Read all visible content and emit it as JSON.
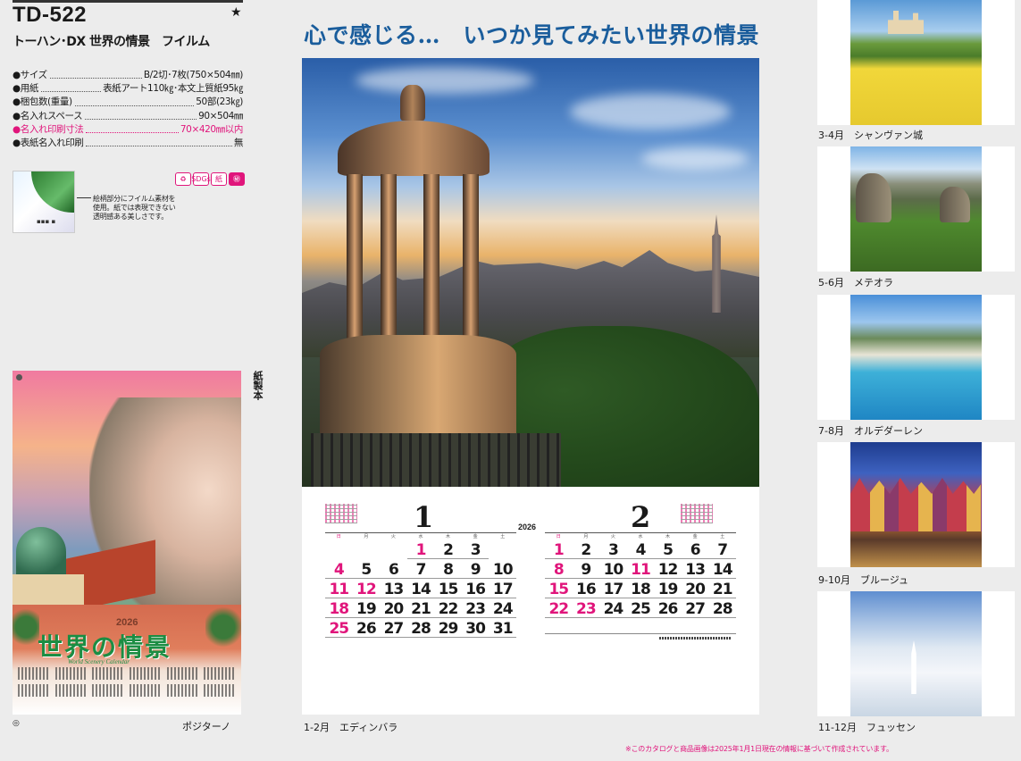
{
  "product": {
    "code": "TD-522",
    "star": "★",
    "name": "トーハン･DX 世界の情景　フイルム"
  },
  "specs": [
    {
      "label": "●サイズ",
      "value": "B/2切･7枚(750×504㎜)",
      "highlight": false
    },
    {
      "label": "●用紙",
      "value": "表紙アート110㎏･本文上質紙95㎏",
      "highlight": false
    },
    {
      "label": "●梱包数(重量)",
      "value": "50部(23㎏)",
      "highlight": false
    },
    {
      "label": "●名入れスペース",
      "value": "90×504㎜",
      "highlight": false
    },
    {
      "label": "●名入れ印刷寸法",
      "value": "70×420㎜以内",
      "highlight": true
    },
    {
      "label": "●表紙名入れ印刷",
      "value": "無",
      "highlight": false
    }
  ],
  "film_note": [
    "絵柄部分にフイルム素材を",
    "使用。紙では表現できない",
    "透明感ある美しさです。"
  ],
  "badges": [
    "♻",
    "SDGs",
    "紙",
    "㊙"
  ],
  "cover": {
    "year": "2026",
    "title": "世界の情景",
    "subtitle": "World Scenery Calendar",
    "side_label": "紙製本",
    "caption": "ポジターノ",
    "mark": "◎"
  },
  "headline": "心で感じる…　いつか見てみたい世界の情景",
  "calendar": {
    "year": "2026",
    "weekday_headers": [
      "日",
      "月",
      "火",
      "水",
      "木",
      "金",
      "土"
    ],
    "months": [
      {
        "label": "1",
        "days": [
          {
            "d": "",
            "t": "empty"
          },
          {
            "d": "",
            "t": "empty"
          },
          {
            "d": "",
            "t": "empty"
          },
          {
            "d": "1",
            "t": "hol"
          },
          {
            "d": "2",
            "t": ""
          },
          {
            "d": "3",
            "t": ""
          },
          {
            "d": "",
            "t": "empty"
          },
          {
            "d": "4",
            "t": "sun"
          },
          {
            "d": "5",
            "t": ""
          },
          {
            "d": "6",
            "t": ""
          },
          {
            "d": "7",
            "t": ""
          },
          {
            "d": "8",
            "t": ""
          },
          {
            "d": "9",
            "t": ""
          },
          {
            "d": "10",
            "t": ""
          },
          {
            "d": "11",
            "t": "sun"
          },
          {
            "d": "12",
            "t": "hol"
          },
          {
            "d": "13",
            "t": ""
          },
          {
            "d": "14",
            "t": ""
          },
          {
            "d": "15",
            "t": ""
          },
          {
            "d": "16",
            "t": ""
          },
          {
            "d": "17",
            "t": ""
          },
          {
            "d": "18",
            "t": "sun"
          },
          {
            "d": "19",
            "t": ""
          },
          {
            "d": "20",
            "t": ""
          },
          {
            "d": "21",
            "t": ""
          },
          {
            "d": "22",
            "t": ""
          },
          {
            "d": "23",
            "t": ""
          },
          {
            "d": "24",
            "t": ""
          },
          {
            "d": "25",
            "t": "sun"
          },
          {
            "d": "26",
            "t": ""
          },
          {
            "d": "27",
            "t": ""
          },
          {
            "d": "28",
            "t": ""
          },
          {
            "d": "29",
            "t": ""
          },
          {
            "d": "30",
            "t": ""
          },
          {
            "d": "31",
            "t": ""
          }
        ]
      },
      {
        "label": "2",
        "days": [
          {
            "d": "1",
            "t": "sun"
          },
          {
            "d": "2",
            "t": ""
          },
          {
            "d": "3",
            "t": ""
          },
          {
            "d": "4",
            "t": ""
          },
          {
            "d": "5",
            "t": ""
          },
          {
            "d": "6",
            "t": ""
          },
          {
            "d": "7",
            "t": ""
          },
          {
            "d": "8",
            "t": "sun"
          },
          {
            "d": "9",
            "t": ""
          },
          {
            "d": "10",
            "t": ""
          },
          {
            "d": "11",
            "t": "hol"
          },
          {
            "d": "12",
            "t": ""
          },
          {
            "d": "13",
            "t": ""
          },
          {
            "d": "14",
            "t": ""
          },
          {
            "d": "15",
            "t": "sun"
          },
          {
            "d": "16",
            "t": ""
          },
          {
            "d": "17",
            "t": ""
          },
          {
            "d": "18",
            "t": ""
          },
          {
            "d": "19",
            "t": ""
          },
          {
            "d": "20",
            "t": ""
          },
          {
            "d": "21",
            "t": ""
          },
          {
            "d": "22",
            "t": "sun"
          },
          {
            "d": "23",
            "t": "hol"
          },
          {
            "d": "24",
            "t": ""
          },
          {
            "d": "25",
            "t": ""
          },
          {
            "d": "26",
            "t": ""
          },
          {
            "d": "27",
            "t": ""
          },
          {
            "d": "28",
            "t": ""
          }
        ]
      }
    ]
  },
  "main_caption": "1-2月　エディンバラ",
  "thumbnails": [
    {
      "caption": "3-4月　シャンヴァン城",
      "scene": "castle-rapeseed"
    },
    {
      "caption": "5-6月　メテオラ",
      "scene": "meteora-rocks"
    },
    {
      "caption": "7-8月　オルデダーレン",
      "scene": "lake-valley"
    },
    {
      "caption": "9-10月　ブルージュ",
      "scene": "bruges-square"
    },
    {
      "caption": "11-12月　フュッセン",
      "scene": "snow-village"
    }
  ],
  "footnote": "※このカタログと商品画像は2025年1月1日現在の情報に基づいて作成されています。",
  "colors": {
    "accent_pink": "#e0157b",
    "headline_blue": "#1a5d9c",
    "background": "#ececec"
  }
}
